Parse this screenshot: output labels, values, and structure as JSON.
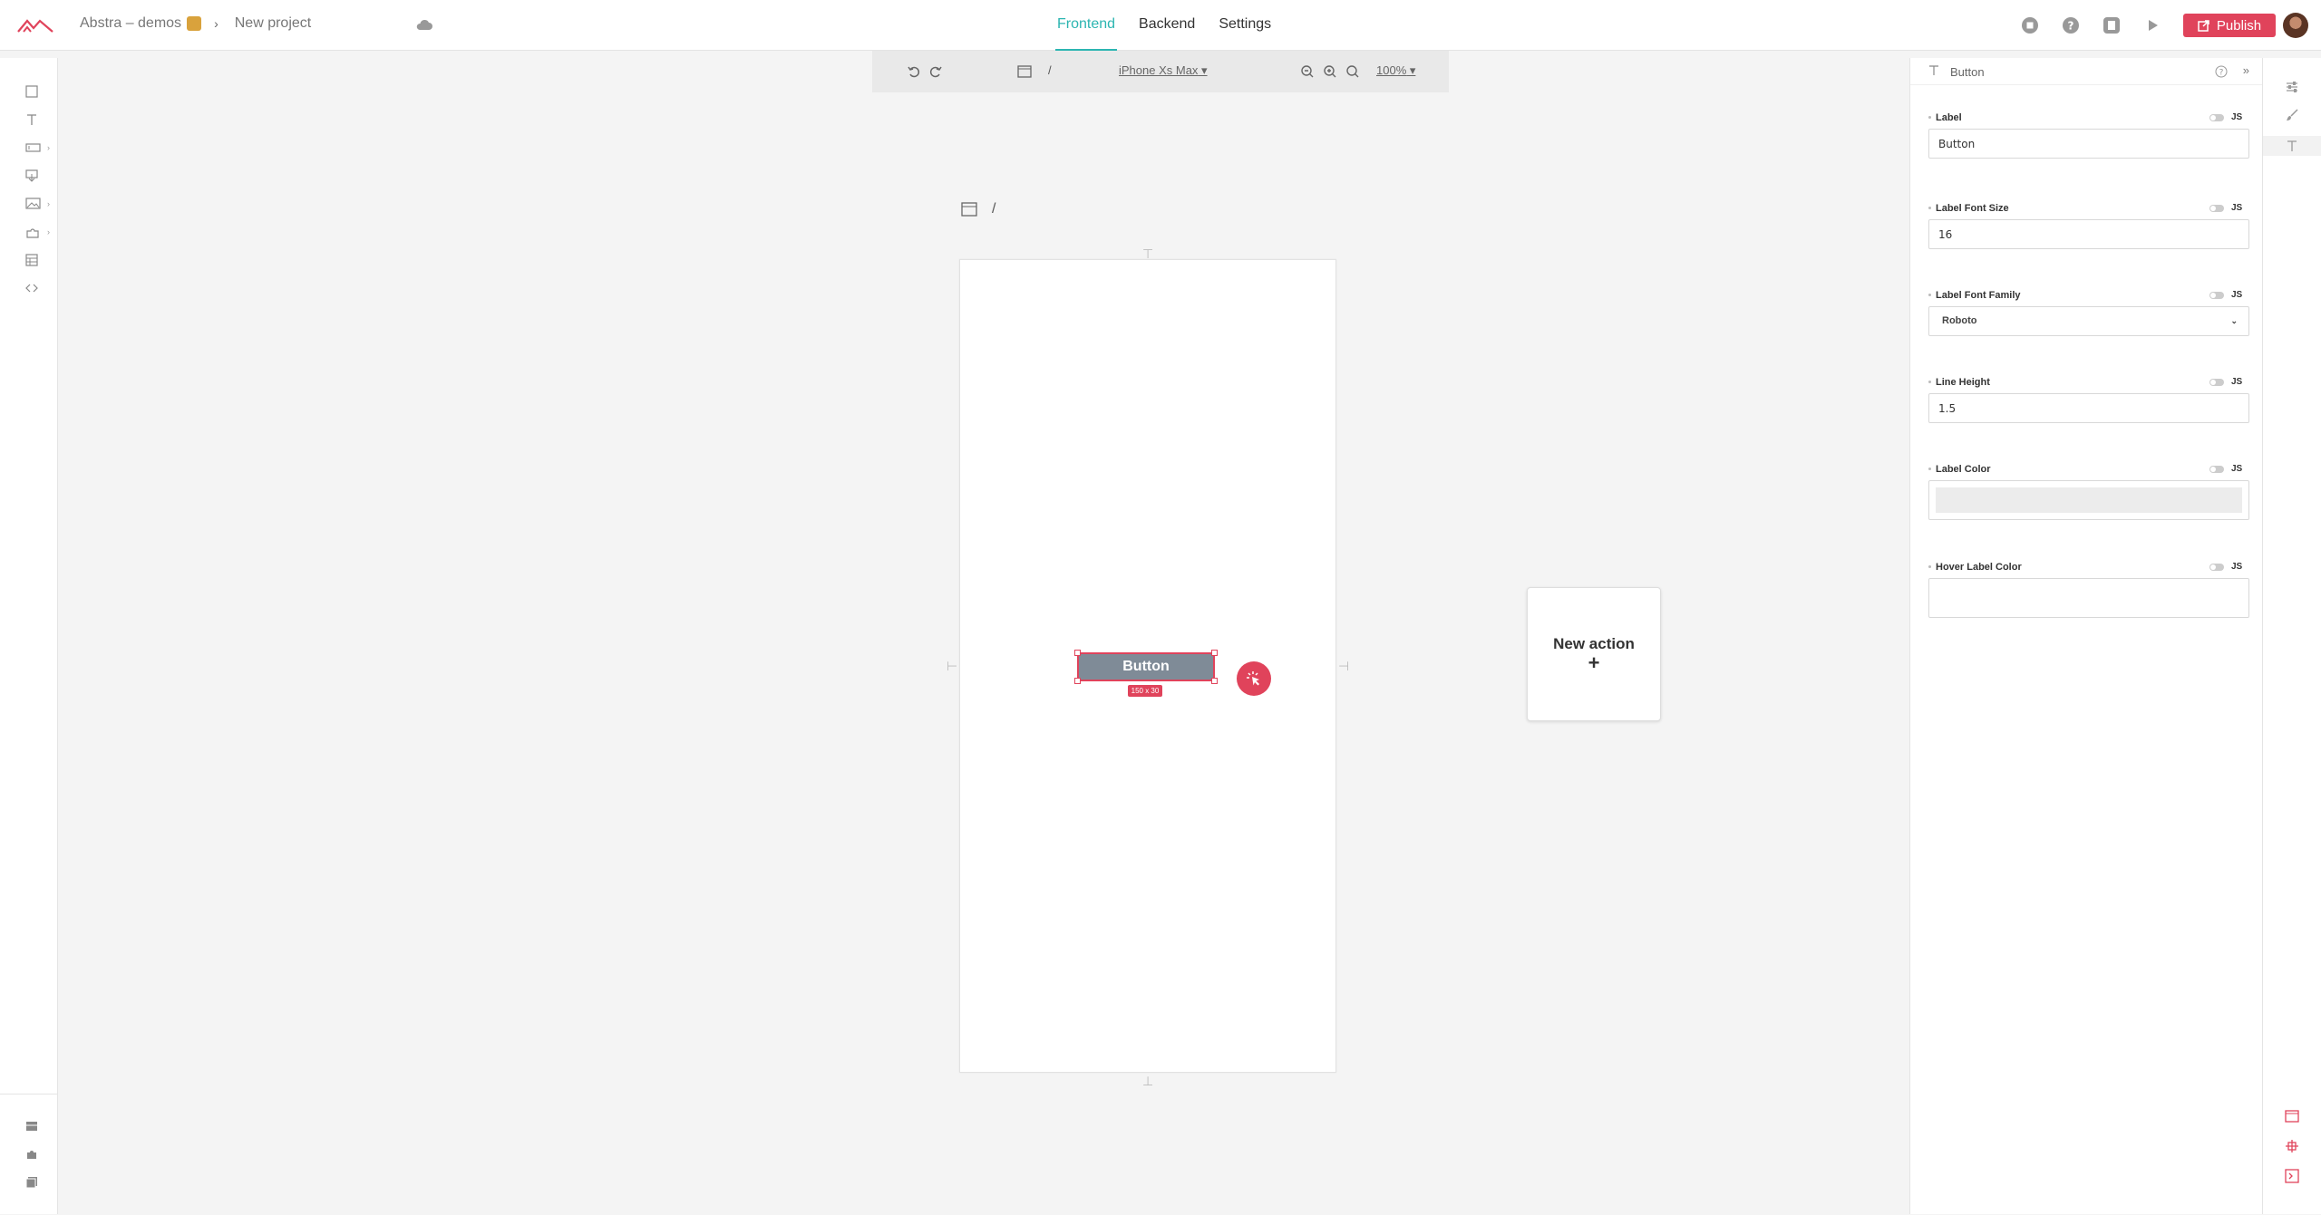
{
  "header": {
    "workspace": "Abstra – demos",
    "project": "New project",
    "tabs": [
      {
        "label": "Frontend",
        "active": true
      },
      {
        "label": "Backend",
        "active": false
      },
      {
        "label": "Settings",
        "active": false
      }
    ],
    "publish_label": "Publish",
    "accent_color": "#e0435b",
    "tab_active_color": "#2cb5b1"
  },
  "left_toolbar": {
    "items": [
      "container-icon",
      "text-icon",
      "input-icon",
      "download-icon",
      "image-icon",
      "plugin-icon",
      "table-icon",
      "code-icon"
    ],
    "bottom_items": [
      "database-icon",
      "puzzle-icon",
      "copy-icon"
    ]
  },
  "canvas_toolbar": {
    "page_path": "/",
    "device": "iPhone Xs Max",
    "zoom": "100%"
  },
  "canvas": {
    "page_path": "/",
    "selected_button_label": "Button",
    "size_badge": "150 x 30",
    "new_action_label": "New action",
    "new_action_plus": "+"
  },
  "properties": {
    "component": "Button",
    "js_label": "JS",
    "fields": [
      {
        "label": "Label",
        "value": "Button",
        "type": "text"
      },
      {
        "label": "Label Font Size",
        "value": "16",
        "type": "text"
      },
      {
        "label": "Label Font Family",
        "value": "Roboto",
        "type": "select"
      },
      {
        "label": "Line Height",
        "value": "1.5",
        "type": "text"
      },
      {
        "label": "Label Color",
        "value": "",
        "type": "color"
      },
      {
        "label": "Hover Label Color",
        "value": "",
        "type": "empty"
      }
    ]
  }
}
